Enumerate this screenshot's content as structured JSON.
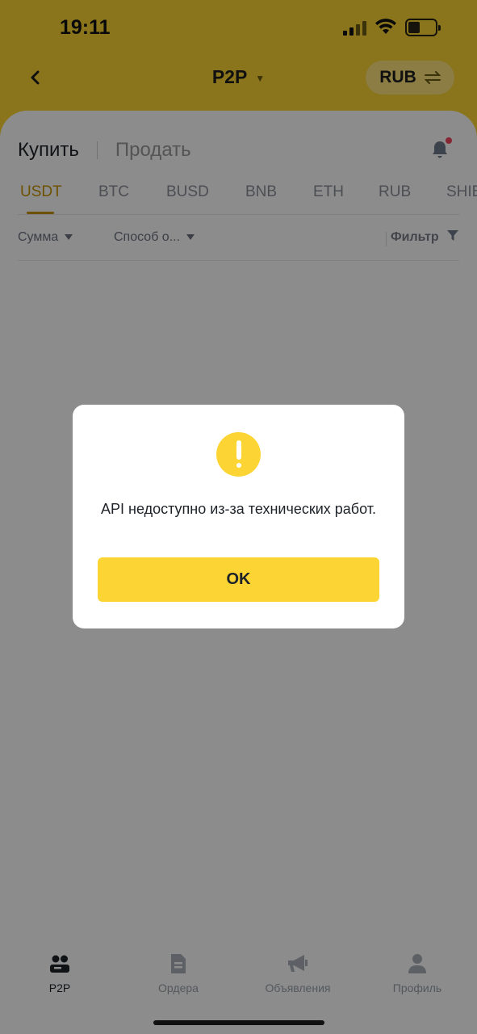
{
  "status_bar": {
    "time": "19:11"
  },
  "header": {
    "title": "P2P",
    "currency": "RUB"
  },
  "trade_tabs": {
    "buy": "Купить",
    "sell": "Продать"
  },
  "coins": [
    {
      "label": "USDT",
      "active": true
    },
    {
      "label": "BTC"
    },
    {
      "label": "BUSD"
    },
    {
      "label": "BNB"
    },
    {
      "label": "ETH"
    },
    {
      "label": "RUB"
    },
    {
      "label": "SHIB"
    }
  ],
  "filters": {
    "amount": "Сумма",
    "payment": "Способ о...",
    "filter": "Фильтр"
  },
  "dialog": {
    "message": "API недоступно из-за технических работ.",
    "ok": "OK"
  },
  "bottom_nav": [
    {
      "label": "P2P",
      "icon": "people-icon",
      "active": true
    },
    {
      "label": "Ордера",
      "icon": "document-icon"
    },
    {
      "label": "Объявления",
      "icon": "megaphone-icon"
    },
    {
      "label": "Профиль",
      "icon": "person-icon"
    }
  ],
  "colors": {
    "brand": "#fcd535",
    "accent": "#c99400",
    "alert_dot": "#f6465d"
  }
}
